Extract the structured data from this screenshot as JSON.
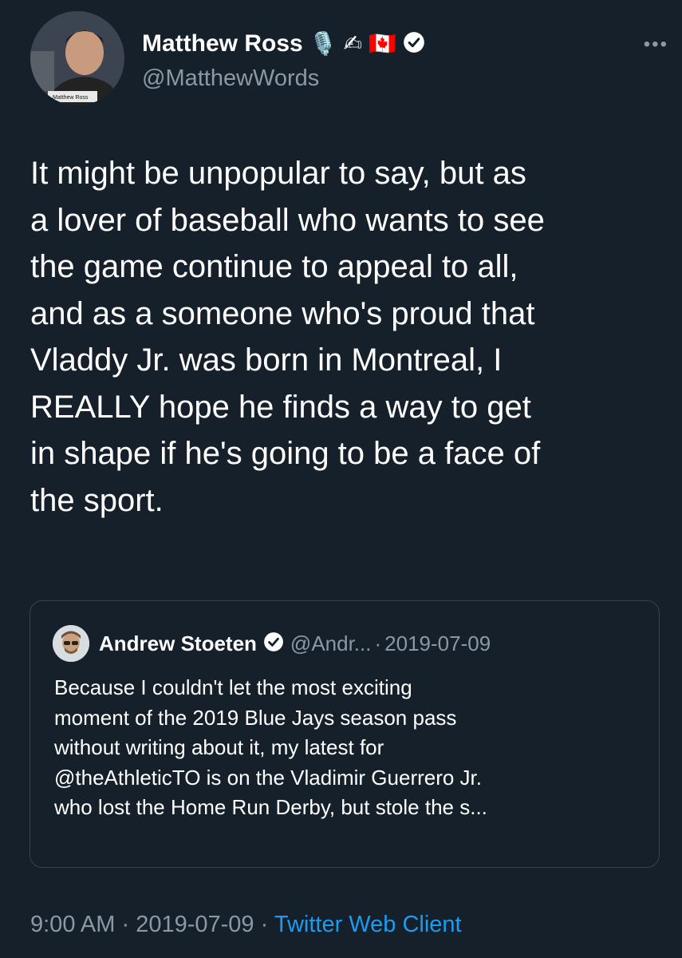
{
  "author": {
    "name": "Matthew Ross",
    "handle": "@MatthewWords",
    "name_emojis": [
      "🎙️",
      "✍",
      "🇨🇦"
    ],
    "verified": true,
    "avatar_caption": "Matthew Ross"
  },
  "more_label": "•••",
  "tweet": {
    "text": "It might be unpopular to say, but as\na lover of baseball who wants to see\nthe game continue to appeal to all,\nand as a someone who's proud that\nVladdy Jr. was born in Montreal, I\nREALLY hope he finds a way to get\nin shape if he's going to be a face of\nthe sport."
  },
  "quoted": {
    "name": "Andrew Stoeten",
    "verified": true,
    "handle": "@Andr...",
    "separator": "·",
    "date": "2019-07-09",
    "text": "Because I couldn't let the most exciting\nmoment of the 2019 Blue Jays season pass\nwithout writing about it, my latest for\n@theAthleticTO is on the Vladimir Guerrero Jr.\nwho lost the Home Run Derby, but stole the s..."
  },
  "footer": {
    "time": "9:00 AM",
    "sep1": "·",
    "date": "2019-07-09",
    "sep2": "·",
    "client": "Twitter Web Client"
  },
  "colors": {
    "background": "#15202b",
    "text": "#ffffff",
    "secondary": "#8b98a5",
    "link": "#1d9bf0",
    "verified": "#ffffff"
  }
}
